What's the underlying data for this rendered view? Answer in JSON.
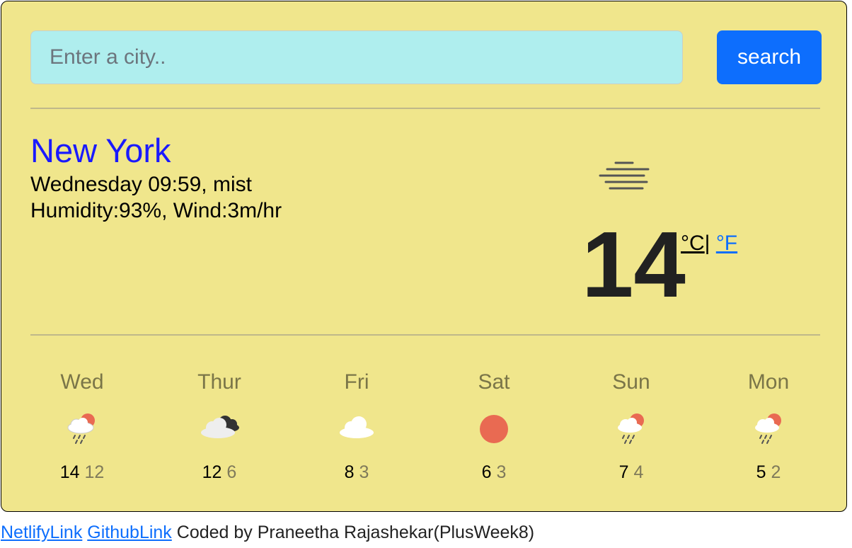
{
  "search": {
    "placeholder": "Enter a city..",
    "button_label": "search"
  },
  "current": {
    "city": "New York",
    "day_time_desc": "Wednesday 09:59, mist",
    "humidity_wind": "Humidity:93%, Wind:3m/hr",
    "condition_icon": "mist-icon",
    "temperature": "14",
    "unit_c": "°C",
    "unit_sep": "|",
    "unit_f": "°F"
  },
  "forecast": [
    {
      "day": "Wed",
      "icon": "rain-sun-icon",
      "max": "14",
      "min": "12"
    },
    {
      "day": "Thur",
      "icon": "broken-clouds-icon",
      "max": "12",
      "min": "6"
    },
    {
      "day": "Fri",
      "icon": "cloud-icon",
      "max": "8",
      "min": "3"
    },
    {
      "day": "Sat",
      "icon": "sun-icon",
      "max": "6",
      "min": "3"
    },
    {
      "day": "Sun",
      "icon": "rain-sun-icon",
      "max": "7",
      "min": "4"
    },
    {
      "day": "Mon",
      "icon": "rain-sun-icon",
      "max": "5",
      "min": "2"
    }
  ],
  "footer": {
    "netlify_link": "NetlifyLink",
    "github_link": "GithubLink",
    "credit": "Coded by Praneetha Rajashekar(PlusWeek8)"
  },
  "colors": {
    "card_bg": "#f0e68c",
    "input_bg": "#afeeee",
    "button_bg": "#0d6efd",
    "city": "#1a1aff",
    "sun": "#e96a52"
  }
}
